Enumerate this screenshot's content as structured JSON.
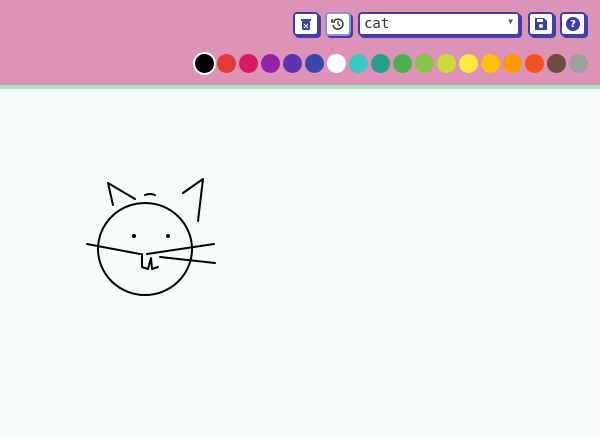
{
  "toolbar": {
    "delete_icon": "trash-icon",
    "history_icon": "history-icon",
    "prompt_value": "cat",
    "save_icon": "floppy-icon",
    "help_icon": "question-icon",
    "help_glyph": "?"
  },
  "palette": [
    "#000000",
    "#e53935",
    "#d81b60",
    "#8e24aa",
    "#5e35b1",
    "#3949ab",
    "#ffffff",
    "#3bc7c4",
    "#26a085",
    "#4caf50",
    "#8bc34a",
    "#cddc39",
    "#ffeb3b",
    "#ffc107",
    "#ff9800",
    "#f4511e",
    "#6d4c41",
    "#9e9e9e"
  ]
}
